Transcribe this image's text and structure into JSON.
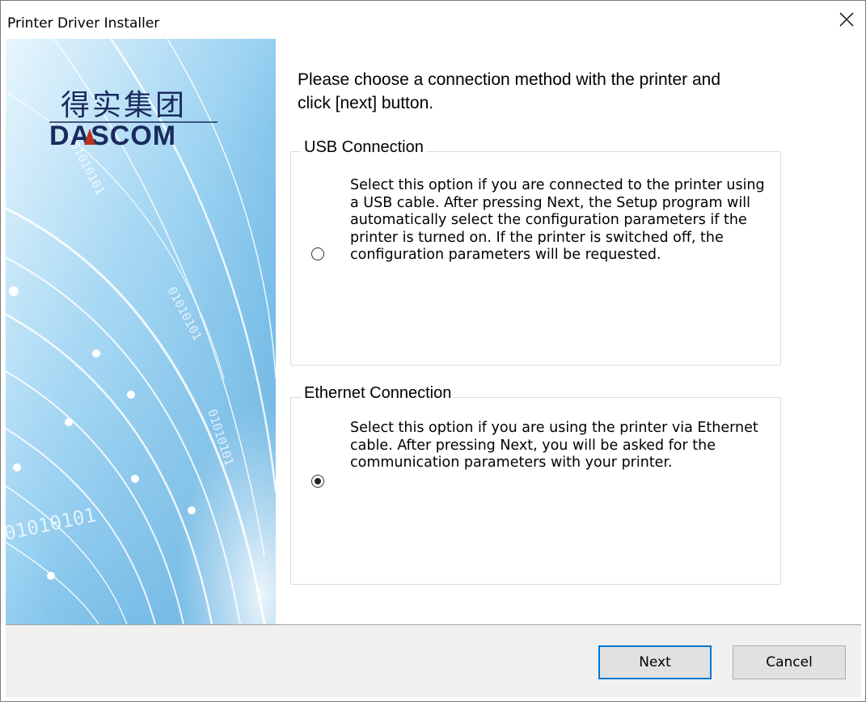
{
  "window": {
    "title": "Printer Driver Installer",
    "close_icon": "close-icon"
  },
  "banner": {
    "logo_chinese": "得实集团",
    "logo_brand": "DASCOM",
    "binary_text": "01010101"
  },
  "content": {
    "instruction": "Please choose a connection method with the printer and click [next] button.",
    "usb": {
      "legend": "USB Connection",
      "selected": false,
      "description": "Select this option if you are connected to the printer using a USB cable. After pressing Next, the Setup program will automatically select the configuration parameters if the printer is turned on. If the printer is switched off, the configuration parameters will be requested."
    },
    "ethernet": {
      "legend": "Ethernet Connection",
      "selected": true,
      "description": "Select this option if you are using the printer via Ethernet cable. After pressing Next, you will be asked for the communication parameters with your printer."
    }
  },
  "footer": {
    "next_label": "Next",
    "cancel_label": "Cancel"
  },
  "colors": {
    "accent": "#0078d7",
    "banner_light": "#cfeaf8",
    "banner_dark": "#3aa0dc",
    "logo_red": "#b8321c",
    "logo_navy": "#1a2a5e"
  }
}
